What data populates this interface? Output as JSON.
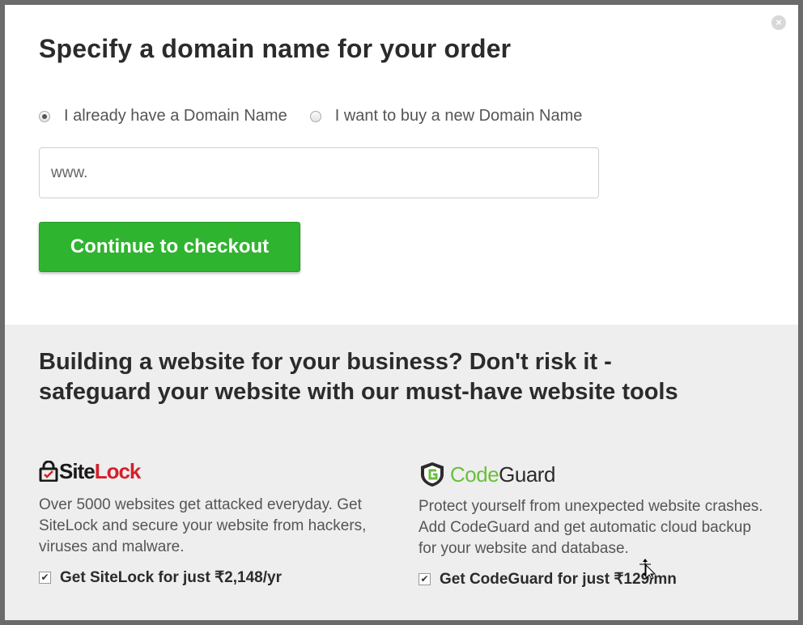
{
  "dialog": {
    "title": "Specify a domain name for your order",
    "close_icon": "close-icon"
  },
  "domain_options": {
    "existing_label": "I already have a Domain Name",
    "new_label": "I want to buy a new Domain Name",
    "selected": "existing"
  },
  "domain_input": {
    "value": "www."
  },
  "checkout_button": {
    "label": "Continue to checkout"
  },
  "promo": {
    "heading": "Building a website for your business? Don't risk it - safeguard your website with our must-have website tools",
    "sitelock": {
      "logo_site": "Site",
      "logo_lock": "Lock",
      "description": "Over 5000 websites get attacked everyday. Get SiteLock and secure your website from hackers, viruses and malware.",
      "offer_label": "Get SiteLock for just ₹2,148/yr",
      "checked": true
    },
    "codeguard": {
      "logo_code": "Code",
      "logo_guard": "Guard",
      "description": "Protect yourself from unexpected website crashes. Add CodeGuard and get automatic cloud backup for your website and database.",
      "offer_label": "Get CodeGuard for just ₹129/mn",
      "checked": true
    }
  },
  "colors": {
    "accent_green": "#2fb42f",
    "sitelock_red": "#d3202a",
    "codeguard_green": "#6abf3b",
    "promo_bg": "#eeeeee"
  }
}
